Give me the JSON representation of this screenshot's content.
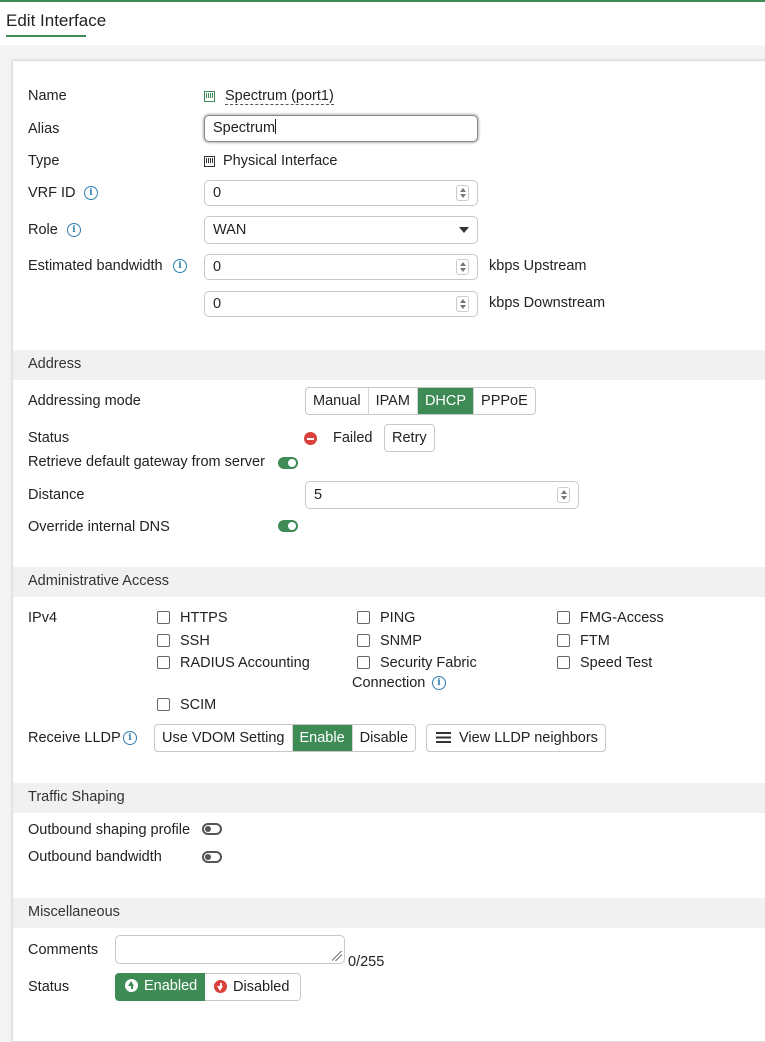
{
  "header": {
    "title": "Edit Interface"
  },
  "general": {
    "name_label": "Name",
    "name_value": "Spectrum (port1)",
    "alias_label": "Alias",
    "alias_value": "Spectrum",
    "type_label": "Type",
    "type_value": "Physical Interface",
    "vrf_label": "VRF ID",
    "vrf_value": "0",
    "role_label": "Role",
    "role_value": "WAN",
    "bandwidth_label": "Estimated bandwidth",
    "upstream_value": "0",
    "upstream_unit": "kbps Upstream",
    "downstream_value": "0",
    "downstream_unit": "kbps Downstream"
  },
  "address": {
    "section_title": "Address",
    "mode_label": "Addressing mode",
    "modes": [
      "Manual",
      "IPAM",
      "DHCP",
      "PPPoE"
    ],
    "selected_mode": "DHCP",
    "status_label": "Status",
    "status_value": "Failed",
    "retry_label": "Retry",
    "gateway_label": "Retrieve default gateway from server",
    "gateway_enabled": true,
    "distance_label": "Distance",
    "distance_value": "5",
    "dns_label": "Override internal DNS",
    "dns_enabled": true
  },
  "admin": {
    "section_title": "Administrative Access",
    "ipv4_label": "IPv4",
    "protocols": {
      "https": "HTTPS",
      "ping": "PING",
      "fmg": "FMG-Access",
      "ssh": "SSH",
      "snmp": "SNMP",
      "ftm": "FTM",
      "radius": "RADIUS Accounting",
      "fabric_1": "Security Fabric",
      "fabric_2": "Connection",
      "speed": "Speed Test",
      "scim": "SCIM"
    },
    "lldp_label": "Receive LLDP",
    "lldp_options": [
      "Use VDOM Setting",
      "Enable",
      "Disable"
    ],
    "lldp_selected": "Enable",
    "lldp_view": "View LLDP neighbors"
  },
  "shaping": {
    "section_title": "Traffic Shaping",
    "profile_label": "Outbound shaping profile",
    "profile_enabled": false,
    "bandwidth_label": "Outbound bandwidth",
    "bandwidth_enabled": false
  },
  "misc": {
    "section_title": "Miscellaneous",
    "comments_label": "Comments",
    "comments_value": "",
    "comments_count": "0/255",
    "status_label": "Status",
    "enabled_label": "Enabled",
    "disabled_label": "Disabled",
    "status_selected": "Enabled"
  },
  "colors": {
    "accent": "#3f8b56",
    "error": "#d9413a",
    "info": "#2f7fb3"
  }
}
